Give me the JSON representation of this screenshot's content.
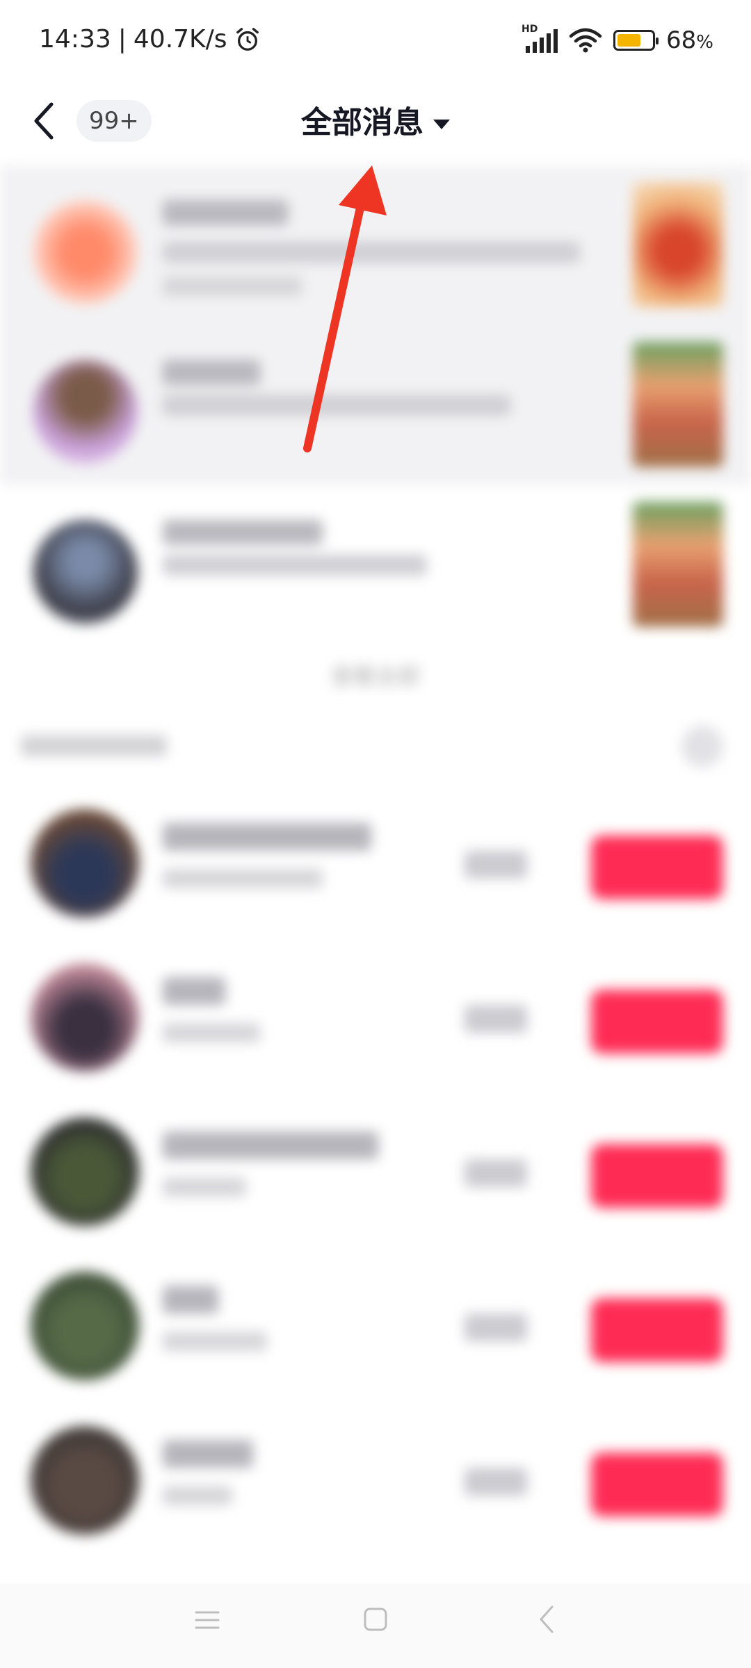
{
  "status_bar": {
    "time": "14:33",
    "net_speed": "40.7K/s",
    "battery_percent": "68",
    "battery_unit": "%",
    "battery_level": 0.68,
    "icons": [
      "alarm-icon",
      "hd-signal-icon",
      "wifi-icon",
      "battery-icon"
    ]
  },
  "header": {
    "back_icon": "chevron-left-icon",
    "unread_count": "99+",
    "title": "全部消息",
    "title_dropdown_icon": "caret-down-icon"
  },
  "content": {
    "see_all_label": "查看全部"
  },
  "annotation": {
    "color": "#ee3524",
    "points_to": "header.title"
  },
  "colors": {
    "accent": "#fe2c55",
    "header_bg": "#ffffff",
    "top_list_bg": "#f2f2f4"
  },
  "system_nav": {
    "icons": [
      "menu-icon",
      "home-icon",
      "back-icon"
    ]
  }
}
